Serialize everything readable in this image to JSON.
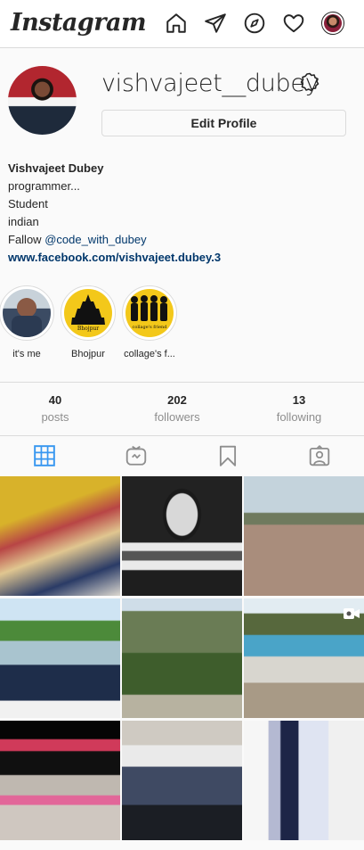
{
  "nav": {
    "logo": "Instagram",
    "icons": [
      "home-icon",
      "direct-icon",
      "explore-icon",
      "activity-icon",
      "profile-avatar"
    ]
  },
  "profile": {
    "username": "vishvajeet__dubey",
    "edit_label": "Edit Profile",
    "full_name": "Vishvajeet Dubey",
    "bio_lines": [
      "programmer...",
      "Student",
      "indian"
    ],
    "fallow_prefix": "Fallow ",
    "mention": "@code_with_dubey",
    "website": "www.facebook.com/vishvajeet.dubey.3"
  },
  "highlights": [
    {
      "label": "it's me"
    },
    {
      "label": "Bhojpur",
      "image_text": "Bhojpur"
    },
    {
      "label": "collage's f...",
      "image_text": "collage's friend"
    }
  ],
  "stats": [
    {
      "count": "40",
      "label": "posts"
    },
    {
      "count": "202",
      "label": "followers"
    },
    {
      "count": "13",
      "label": "following"
    }
  ],
  "tabs": [
    "posts-grid-tab",
    "igtv-tab",
    "saved-tab",
    "tagged-tab"
  ],
  "colors": {
    "accent": "#3897f0",
    "link": "#00376b",
    "border": "#dbdbdb",
    "muted": "#8e8e8e"
  }
}
